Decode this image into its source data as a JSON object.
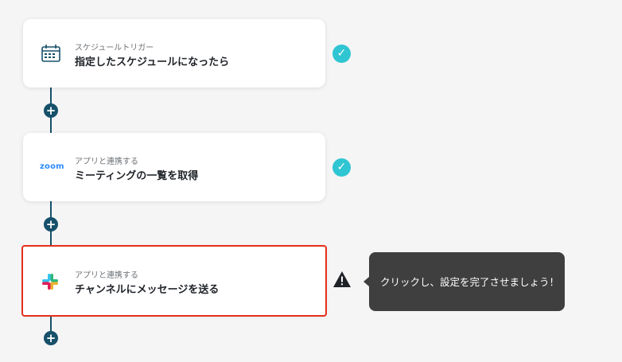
{
  "steps": [
    {
      "subtitle": "スケジュールトリガー",
      "title": "指定したスケジュールになったら",
      "icon": "calendar-schedule-icon",
      "status": "complete"
    },
    {
      "subtitle": "アプリと連携する",
      "title": "ミーティングの一覧を取得",
      "icon": "zoom-logo",
      "app_logo_text": "zoom",
      "status": "complete"
    },
    {
      "subtitle": "アプリと連携する",
      "title": "チャンネルにメッセージを送る",
      "icon": "slack-logo",
      "status": "warning"
    }
  ],
  "tooltip": {
    "text": "クリックし、設定を完了させましょう！"
  },
  "colors": {
    "connector": "#16506a",
    "check": "#2fc5d2",
    "highlight": "#e4301a",
    "tooltip_bg": "#3f3f40",
    "zoom": "#2d8cff"
  }
}
